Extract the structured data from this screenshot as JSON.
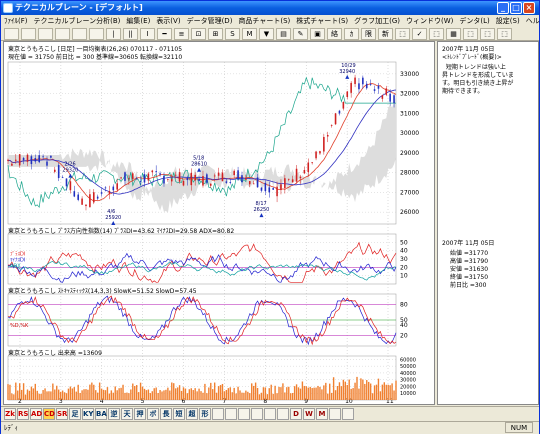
{
  "window": {
    "title": "テクニカルブレーン - [デフォルト]"
  },
  "menu": [
    "ﾌｧｲﾙ(F)",
    "テクニカルブレーン分析(B)",
    "編集(E)",
    "表示(V)",
    "データ管理(D)",
    "商品チャート(S)",
    "株式チャート(S)",
    "グラフ加工(G)",
    "ウィンドウ(W)",
    "デンタ(L)",
    "設定(S)",
    "ヘルプ(H)"
  ],
  "toolbar": [
    "",
    "",
    "",
    "",
    "",
    "",
    "|",
    "||",
    "Ⅰ",
    "━",
    "≡",
    "⊡",
    "⊞",
    "S",
    "M",
    "▼",
    "▤",
    "✎",
    "▣",
    "絡",
    "ｶ",
    "限",
    "新",
    "⬚",
    "✓",
    "⬚",
    "▦",
    "⬚",
    "⬚",
    "⬚"
  ],
  "chart1": {
    "header": "東京とうもろこし [日足] 一目均衡表(26,26) 070117 - 071105",
    "subheader": "現在値 = 31750  前日比 = 300  基準線=30605  転換線=32110",
    "annotations": [
      {
        "label": "2/26",
        "value": "29320"
      },
      {
        "label": "4/6",
        "value": "25920"
      },
      {
        "label": "5/18",
        "value": "28610"
      },
      {
        "label": "8/17",
        "value": "26250"
      },
      {
        "label": "10/29",
        "value": "32940"
      }
    ],
    "yticks": [
      "33000",
      "32000",
      "31000",
      "30000",
      "29000",
      "28000",
      "27000",
      "26000"
    ]
  },
  "chart2": {
    "header": "東京とうもろこし  ﾌﾞﾗｽ方向性指数(14) ﾌﾟﾗｽDI=43.62  ﾏｲﾅｽDI=29.58  ADX=80.82",
    "legend": [
      "ﾌﾟﾗｽDI",
      "ﾏｲﾅｽDI",
      "ADX"
    ],
    "yticks": [
      "50",
      "40",
      "30",
      "20",
      "10"
    ]
  },
  "chart3": {
    "header": "東京とうもろこし  ｽﾄｷｬｽﾃｨｯｸｽ(14,3,3) SlowK=51.52  SlowD=57.45",
    "legend": "%D,%K",
    "yticks": [
      "80",
      "50",
      "40",
      "20"
    ]
  },
  "chart4": {
    "header": "東京とうもろこし  出来高 =13609",
    "yticks": [
      "60000",
      "50000",
      "40000",
      "30000",
      "20000",
      "10000"
    ]
  },
  "xaxis": [
    "2",
    "3",
    "4",
    "5",
    "6",
    "7",
    "8",
    "9",
    "10",
    "11"
  ],
  "rightPanel": {
    "note_date": "2007年 11月 05日",
    "note_title": "<ﾄﾚﾝﾄﾞﾌﾟﾚｰﾄﾞ(概要)>",
    "note_body": "  短期トレンドは強い上\n昇トレンドを形成していま\nす。明日も引き続き上昇が\n期待できます。",
    "price_date": "2007年 11月 05日",
    "prices": [
      "始値 =31770",
      "高値 =31790",
      "安値 =31630",
      "終値 =31750",
      "前日比 =300"
    ]
  },
  "bottombar": [
    "Zk",
    "RS",
    "AD",
    "CD",
    "SR",
    "足",
    "KY",
    "BA",
    "逆",
    "天",
    "押",
    "ボ",
    "長",
    "短",
    "超",
    "形",
    "",
    "",
    "",
    "",
    "",
    "",
    "D",
    "W",
    "M",
    "",
    ""
  ],
  "status": {
    "text": "ﾚﾃﾞｨ",
    "num": "NUM"
  },
  "chart_data": {
    "type": "line",
    "title": "東京とうもろこし [日足] 一目均衡表(26,26) 070117 - 071105",
    "xlabel": "",
    "ylabel": "",
    "ylim": [
      25400,
      33600
    ],
    "x": [
      "2",
      "3",
      "4",
      "5",
      "6",
      "7",
      "8",
      "9",
      "10",
      "11"
    ],
    "series": [
      {
        "name": "終値",
        "values": [
          28600,
          28800,
          26400,
          27700,
          27800,
          27600,
          27900,
          27100,
          28800,
          32600,
          31750
        ]
      }
    ]
  }
}
